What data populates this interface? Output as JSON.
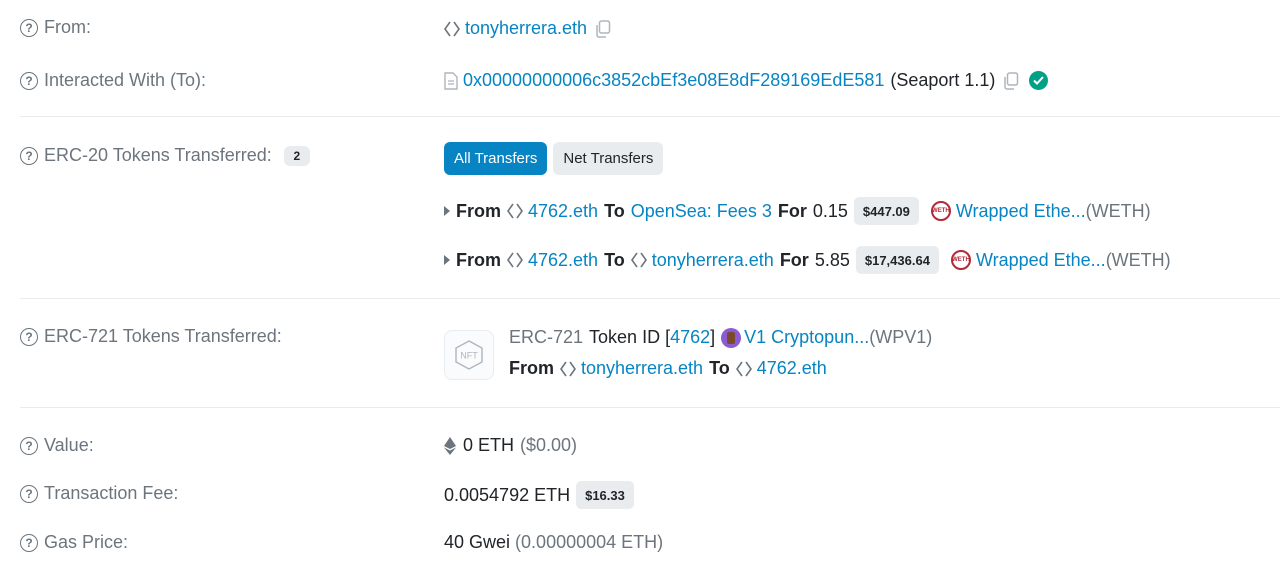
{
  "colors": {
    "link": "#0784c3",
    "label": "#6c757d",
    "badge_bg": "#e9ecef",
    "success": "#00a186"
  },
  "from": {
    "label": "From:",
    "address": "tonyherrera.eth"
  },
  "to": {
    "label": "Interacted With (To):",
    "address": "0x00000000006c3852cbEf3e08E8dF289169EdE581",
    "name": "(Seaport 1.1)"
  },
  "erc20": {
    "label": "ERC-20 Tokens Transferred:",
    "count": "2",
    "tabs": {
      "all": "All Transfers",
      "net": "Net Transfers"
    },
    "transfers": [
      {
        "from_word": "From",
        "from": "4762.eth",
        "to_word": "To",
        "to": "OpenSea: Fees 3",
        "for_word": "For",
        "amount": "0.15",
        "usd": "$447.09",
        "token_logo": "WETH",
        "token_name": "Wrapped Ethe...",
        "token_symbol": "(WETH)"
      },
      {
        "from_word": "From",
        "from": "4762.eth",
        "to_word": "To",
        "to": "tonyherrera.eth",
        "for_word": "For",
        "amount": "5.85",
        "usd": "$17,436.64",
        "token_logo": "WETH",
        "token_name": "Wrapped Ethe...",
        "token_symbol": "(WETH)"
      }
    ]
  },
  "erc721": {
    "label": "ERC-721 Tokens Transferred:",
    "thumb_text": "NFT",
    "standard": "ERC-721",
    "token_id_label": "Token ID [",
    "token_id": "4762",
    "token_id_close": "]",
    "collection": "V1 Cryptopun...",
    "symbol": "(WPV1)",
    "from_word": "From",
    "from": "tonyherrera.eth",
    "to_word": "To",
    "to": "4762.eth"
  },
  "value": {
    "label": "Value:",
    "amount": "0 ETH",
    "usd": "($0.00)"
  },
  "fee": {
    "label": "Transaction Fee:",
    "amount": "0.0054792 ETH",
    "usd": "$16.33"
  },
  "gas": {
    "label": "Gas Price:",
    "amount": "40 Gwei",
    "eth": "(0.00000004 ETH)"
  }
}
